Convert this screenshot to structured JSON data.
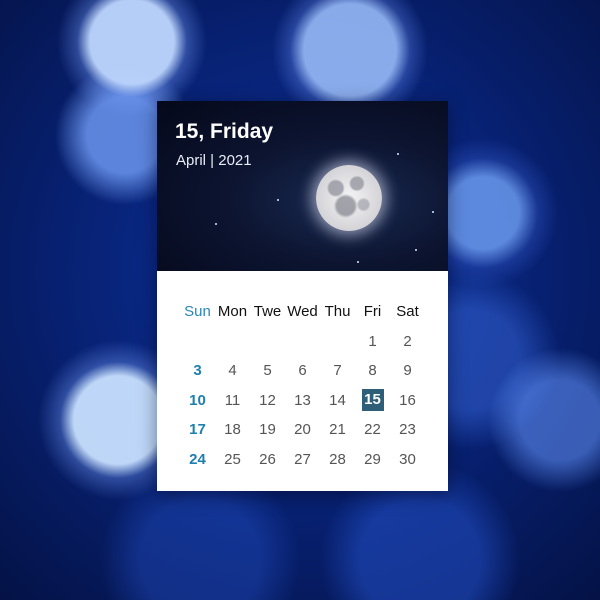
{
  "widget": {
    "day_title": "15, Friday",
    "month_year": "April | 2021",
    "weekdays": [
      "Sun",
      "Mon",
      "Twe",
      "Wed",
      "Thu",
      "Fri",
      "Sat"
    ],
    "weeks": [
      [
        "",
        "",
        "",
        "",
        "",
        "1",
        "2"
      ],
      [
        "3",
        "4",
        "5",
        "6",
        "7",
        "8",
        "9"
      ],
      [
        "10",
        "11",
        "12",
        "13",
        "14",
        "15",
        "16"
      ],
      [
        "17",
        "18",
        "19",
        "20",
        "21",
        "22",
        "23"
      ],
      [
        "24",
        "25",
        "26",
        "27",
        "28",
        "29",
        "30"
      ]
    ],
    "today": "15"
  },
  "colors": {
    "sunday_accent": "#2a86b8",
    "today_highlight": "#2f5e78",
    "hero_background": "#0c1430"
  },
  "icons": [
    "moon-image",
    "star-decoration"
  ]
}
